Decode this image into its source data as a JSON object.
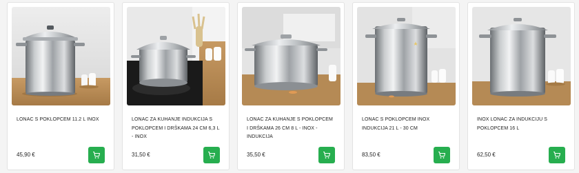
{
  "colors": {
    "cart_button": "#27ae4f",
    "text": "#222222",
    "card_border": "#e2e2e2"
  },
  "products": [
    {
      "title": "LONAC S POKLOPCEM 11.2 L INOX",
      "price": "45,90 €",
      "image": "stainless-stock-pot-with-lid"
    },
    {
      "title": "LONAC ZA KUHANJE INDUKCIJA S POKLOPCEM I DRŠKAMA 24 cm 6,3 L - INOX",
      "price": "31,50 €",
      "image": "stainless-pot-on-induction-hob"
    },
    {
      "title": "LONAC ZA KUHANJE S POKLOPCEM I DRŠKAMA 26 cm 8 L - INOX - INDUKCIJA",
      "price": "35,50 €",
      "image": "stainless-low-pot-with-lid"
    },
    {
      "title": "LONAC S POKLOPCEM INOX INDUKCIJA 21 L - 30 cm",
      "price": "83,50 €",
      "image": "stainless-tall-stock-pot"
    },
    {
      "title": "INOX LONAC ZA INDUKCIJU S POKLOPCEM 16 L",
      "price": "62,50 €",
      "image": "stainless-stock-pot-16l"
    }
  ],
  "cart_icon": "shopping-cart-icon"
}
